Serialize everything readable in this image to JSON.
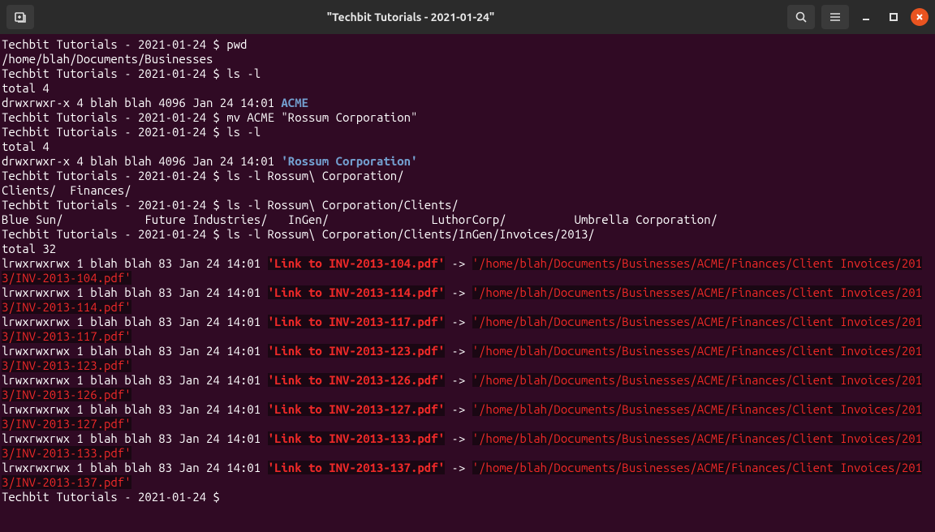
{
  "titlebar": {
    "title": "\"Techbit Tutorials - 2021-01-24\""
  },
  "prompt": "Techbit Tutorials - 2021-01-24 $ ",
  "pwd": {
    "cmd": "pwd",
    "out": "/home/blah/Documents/Businesses"
  },
  "ls1": {
    "cmd": "ls -l",
    "total": "total 4",
    "perm": "drwxrwxr-x 4 blah blah 4096 Jan 24 14:01 ",
    "dir": "ACME"
  },
  "mv": {
    "cmd": "mv ACME \"Rossum Corporation\""
  },
  "ls2": {
    "cmd": "ls -l",
    "total": "total 4",
    "perm": "drwxrwxr-x 4 blah blah 4096 Jan 24 14:01 ",
    "dir": "'Rossum Corporation'"
  },
  "ls3": {
    "cmd": "ls -l Rossum\\ Corporation/",
    "out": "Clients/  Finances/"
  },
  "ls4": {
    "cmd": "ls -l Rossum\\ Corporation/Clients/",
    "out": "Blue Sun/            Future Industries/   InGen/               LuthorCorp/          Umbrella Corporation/"
  },
  "ls5": {
    "cmd": "ls -l Rossum\\ Corporation/Clients/InGen/Invoices/2013/",
    "total": "total 32",
    "perm": "lrwxrwxrwx 1 blah blah 83 Jan 24 14:01 ",
    "arrow": " -> ",
    "links": [
      {
        "name": "'Link to INV-2013-104.pdf'",
        "target": "'/home/blah/Documents/Businesses/ACME/Finances/Client Invoices/2013/INV-2013-104.pdf'"
      },
      {
        "name": "'Link to INV-2013-114.pdf'",
        "target": "'/home/blah/Documents/Businesses/ACME/Finances/Client Invoices/2013/INV-2013-114.pdf'"
      },
      {
        "name": "'Link to INV-2013-117.pdf'",
        "target": "'/home/blah/Documents/Businesses/ACME/Finances/Client Invoices/2013/INV-2013-117.pdf'"
      },
      {
        "name": "'Link to INV-2013-123.pdf'",
        "target": "'/home/blah/Documents/Businesses/ACME/Finances/Client Invoices/2013/INV-2013-123.pdf'"
      },
      {
        "name": "'Link to INV-2013-126.pdf'",
        "target": "'/home/blah/Documents/Businesses/ACME/Finances/Client Invoices/2013/INV-2013-126.pdf'"
      },
      {
        "name": "'Link to INV-2013-127.pdf'",
        "target": "'/home/blah/Documents/Businesses/ACME/Finances/Client Invoices/2013/INV-2013-127.pdf'"
      },
      {
        "name": "'Link to INV-2013-133.pdf'",
        "target": "'/home/blah/Documents/Businesses/ACME/Finances/Client Invoices/2013/INV-2013-133.pdf'"
      },
      {
        "name": "'Link to INV-2013-137.pdf'",
        "target": "'/home/blah/Documents/Businesses/ACME/Finances/Client Invoices/2013/INV-2013-137.pdf'"
      }
    ]
  }
}
